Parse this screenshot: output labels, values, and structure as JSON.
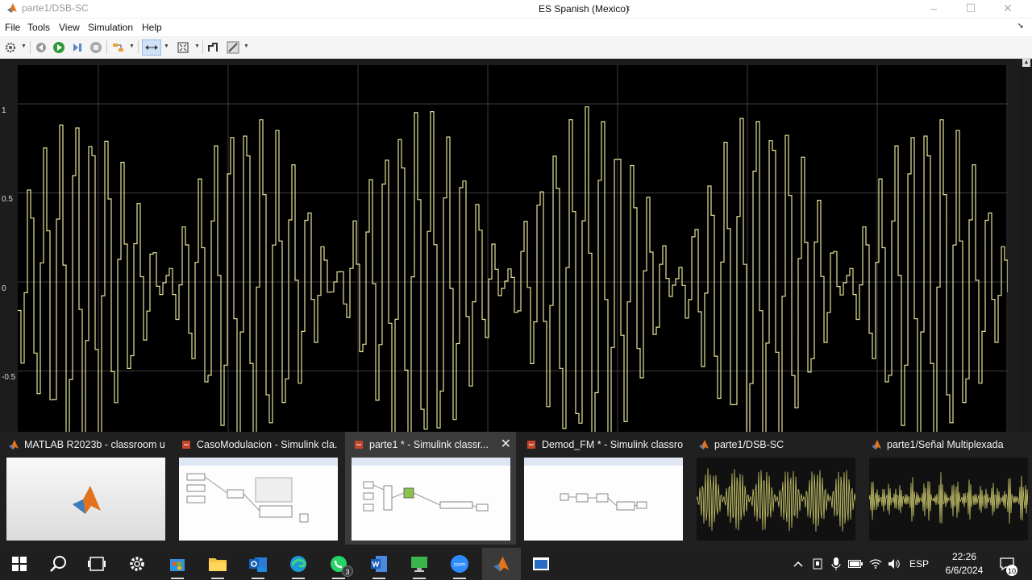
{
  "window": {
    "title": "parte1/DSB-SC",
    "language": "ES Spanish (Mexico)"
  },
  "menu": [
    "File",
    "Tools",
    "View",
    "Simulation",
    "Help"
  ],
  "toolbar": {
    "icons": [
      "gear-icon",
      "step-back-icon",
      "run-icon",
      "step-forward-icon",
      "stop-icon",
      "highlight-icon",
      "zoom-axes-icon",
      "fit-to-view-icon",
      "cursor-measure-icon",
      "edit-style-icon"
    ],
    "active": "zoom-axes-icon"
  },
  "scope": {
    "y_ticks": [
      "1",
      "0.5",
      "0",
      "-0.5"
    ],
    "colors": {
      "background": "#000000",
      "grid": "#3c3c3c",
      "trace": "#e5e39a"
    }
  },
  "chart_data": {
    "type": "line",
    "title": "",
    "xlabel": "",
    "ylabel": "",
    "ylim": [
      -0.8,
      1.25
    ],
    "y_ticks": [
      1,
      0.5,
      0,
      -0.5
    ],
    "series": [
      {
        "description": "DSB-SC modulated signal (stepped)",
        "carrier_cycles_per_envelope": 11,
        "envelope_peaks": [
          0.95,
          0.97,
          0.98,
          0.99,
          0.99,
          0.97
        ]
      }
    ]
  },
  "task_switcher": [
    {
      "title": "MATLAB R2023b - classroom u...",
      "icon": "matlab-icon",
      "selected": false
    },
    {
      "title": "CasoModulacion - Simulink cla...",
      "icon": "simulink-icon",
      "selected": false
    },
    {
      "title": "parte1 * - Simulink classr...",
      "icon": "simulink-icon",
      "selected": true,
      "close": "✕"
    },
    {
      "title": "Demod_FM * - Simulink classro...",
      "icon": "simulink-icon",
      "selected": false
    },
    {
      "title": "parte1/DSB-SC",
      "icon": "matlab-icon",
      "selected": false
    },
    {
      "title": "parte1/Señal Multiplexada",
      "icon": "matlab-icon",
      "selected": false
    }
  ],
  "taskbar": {
    "apps": [
      "windows-start-icon",
      "search-icon",
      "task-view-icon",
      "settings-icon",
      "store-icon",
      "file-explorer-icon",
      "outlook-icon",
      "edge-icon",
      "whatsapp-icon",
      "word-icon",
      "remote-desktop-icon",
      "zoom-icon",
      "matlab-icon",
      "window-icon"
    ],
    "whatsapp_badge": "3",
    "tray_language": "ESP",
    "time": "22:26",
    "date": "6/6/2024",
    "notifications": "10"
  }
}
